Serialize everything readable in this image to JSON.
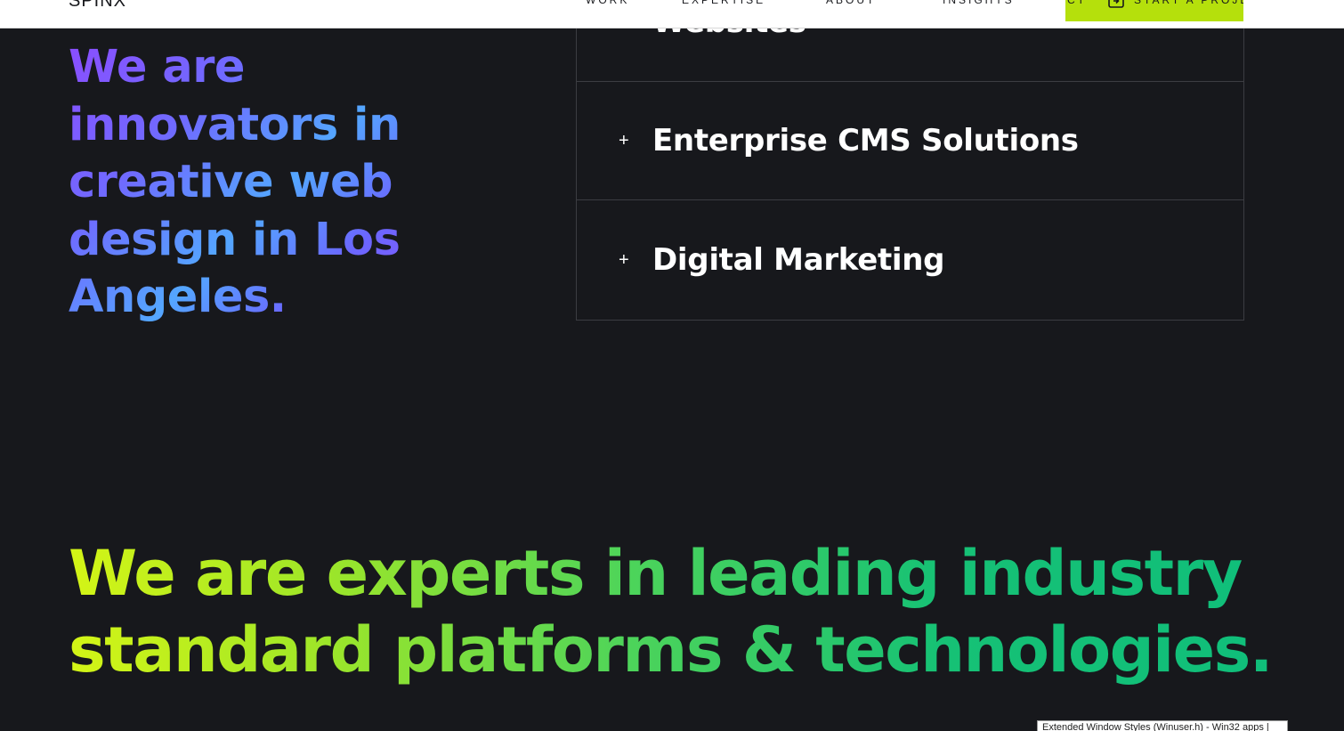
{
  "header": {
    "logo": "SPINX",
    "nav": [
      "WORK",
      "EXPERTISE",
      "ABOUT",
      "INSIGHTS"
    ],
    "contact_fragment": "CT",
    "cta_label": "START A PROJE",
    "cta_icon": "external-link-icon",
    "cta_color": "#b5e00c"
  },
  "intro": {
    "heading": "We are innovators in creative web design in Los Angeles."
  },
  "services": {
    "items": [
      {
        "title": "Websites",
        "icon": "plus-icon"
      },
      {
        "title": "Enterprise CMS Solutions",
        "icon": "plus-icon"
      },
      {
        "title": "Digital Marketing",
        "icon": "plus-icon"
      }
    ],
    "plus_symbol": "+"
  },
  "experts": {
    "heading": "We are experts in leading industry standard platforms & technologies."
  },
  "tooltip": {
    "text": "Extended Window Styles (Winuser.h) - Win32 apps |"
  },
  "colors": {
    "background": "#17181c",
    "accent_green": "#b5e00c",
    "border": "#3c3d42"
  }
}
